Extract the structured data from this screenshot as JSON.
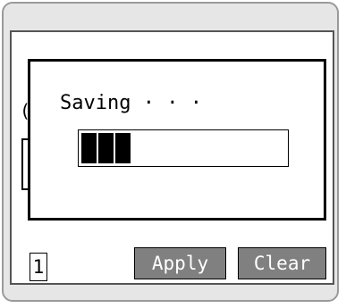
{
  "dialog": {
    "message": "Saving · · ·",
    "progress_segments_filled": 3
  },
  "background": {
    "partial_glyph": "("
  },
  "footer": {
    "page_number": "1",
    "apply_label": "Apply",
    "clear_label": "Clear"
  }
}
